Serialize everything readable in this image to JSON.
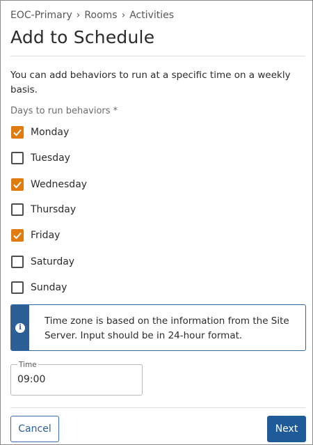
{
  "breadcrumb": {
    "items": [
      "EOC-Primary",
      "Rooms",
      "Activities"
    ],
    "separator": "›"
  },
  "page": {
    "title": "Add to Schedule",
    "description": "You can add behaviors to run at a specific time on a weekly basis."
  },
  "days": {
    "label": "Days to run behaviors *",
    "items": [
      {
        "label": "Monday",
        "checked": true
      },
      {
        "label": "Tuesday",
        "checked": false
      },
      {
        "label": "Wednesday",
        "checked": true
      },
      {
        "label": "Thursday",
        "checked": false
      },
      {
        "label": "Friday",
        "checked": true
      },
      {
        "label": "Saturday",
        "checked": false
      },
      {
        "label": "Sunday",
        "checked": false
      }
    ]
  },
  "info": {
    "icon": "info-icon",
    "text": "Time zone is based on the information from the Site Server. Input should be in 24-hour format."
  },
  "time": {
    "label": "Time",
    "value": "09:00"
  },
  "buttons": {
    "cancel": "Cancel",
    "next": "Next"
  },
  "colors": {
    "checkbox_checked": "#e07b10",
    "primary": "#1f5b99",
    "info_strip": "#2b5f96"
  }
}
